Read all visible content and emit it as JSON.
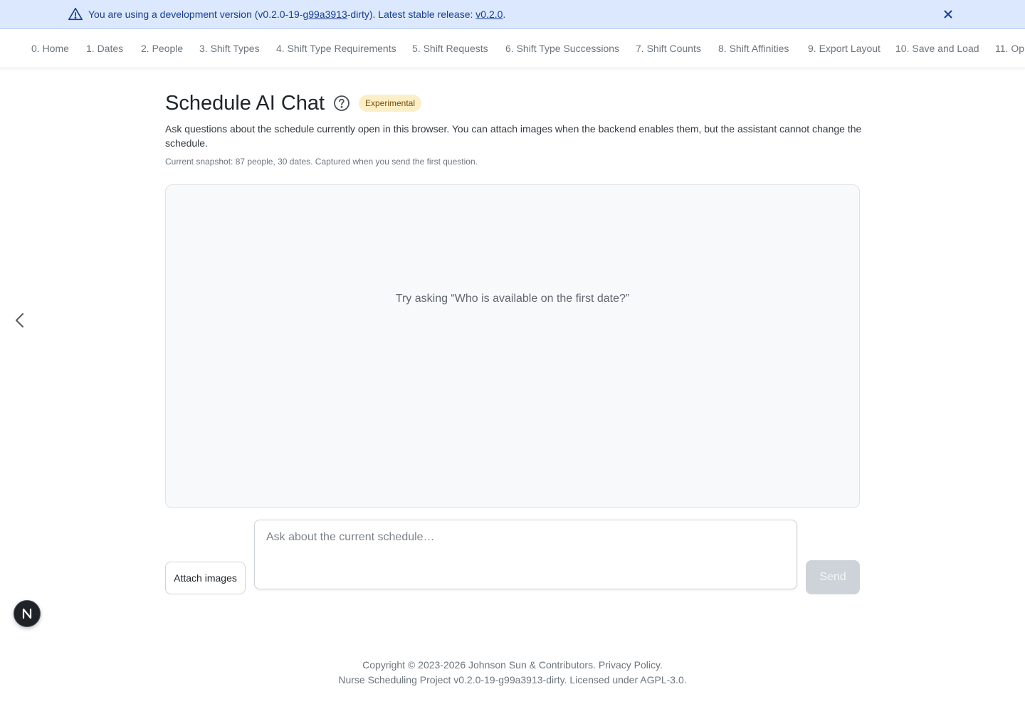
{
  "banner": {
    "text_prefix": "You are using a development version (v0.2.0-19-",
    "commit_link": "g99a3913",
    "text_mid": "-dirty). Latest stable release: ",
    "stable_link": "v0.2.0",
    "text_suffix": ".",
    "icon": "warning-triangle-icon",
    "close_icon": "close-icon"
  },
  "nav": {
    "items": [
      "0. Home",
      "1. Dates",
      "2. People",
      "3. Shift Types",
      "4. Shift Type Requirements",
      "5. Shift Requests",
      "6. Shift Type Successions",
      "7. Shift Counts",
      "8. Shift Affinities",
      "9. Export Layout",
      "10. Save and Load",
      "11. Op"
    ]
  },
  "page": {
    "title": "Schedule AI Chat",
    "badge": "Experimental",
    "description": "Ask questions about the schedule currently open in this browser. You can attach images when the backend enables them, but the assistant cannot change the schedule.",
    "snapshot": "Current snapshot: 87 people, 30 dates. Captured when you send the first question."
  },
  "chat": {
    "empty_hint": "Try asking “Who is available on the first date?”"
  },
  "composer": {
    "attach_label": "Attach images",
    "placeholder": "Ask about the current schedule…",
    "value": "",
    "send_label": "Send"
  },
  "avatar": {
    "letter": "N"
  },
  "footer": {
    "line1_prefix": "Copyright © 2023-2026 Johnson Sun & Contributors. ",
    "privacy_link": "Privacy Policy",
    "line1_suffix": ".",
    "line2": "Nurse Scheduling Project v0.2.0-19-g99a3913-dirty. Licensed under AGPL-3.0."
  },
  "colors": {
    "banner_bg": "#dbe8fd",
    "banner_text": "#1a3d8f",
    "badge_bg": "#fcefc8",
    "badge_text": "#7a4a05",
    "send_disabled": "#ced3d9"
  }
}
